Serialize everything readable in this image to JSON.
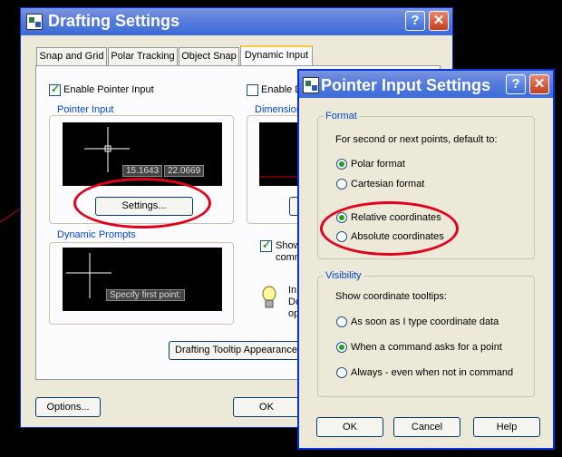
{
  "drafting": {
    "title": "Drafting Settings",
    "tabs": [
      "Snap and Grid",
      "Polar Tracking",
      "Object Snap",
      "Dynamic Input"
    ],
    "enable_pointer": "Enable Pointer Input",
    "enable_dim": "Enable D",
    "pointer_group": "Pointer Input",
    "dim_group": "Dimension",
    "coords": [
      "15.1643",
      "22.0669"
    ],
    "settings_btn": "Settings...",
    "prompts_group": "Dynamic Prompts",
    "prompt_tip": "Specify first point:",
    "show_lines": [
      "Show",
      "comm"
    ],
    "info_lines": [
      "In",
      "Do",
      "op"
    ],
    "appearance_btn": "Drafting Tooltip Appearance...",
    "options_btn": "Options...",
    "ok_btn": "OK"
  },
  "pointer_dialog": {
    "title": "Pointer Input Settings",
    "format_group": "Format",
    "format_desc": "For second or next points, default to:",
    "polar": "Polar format",
    "cartesian": "Cartesian format",
    "relative": "Relative coordinates",
    "absolute": "Absolute coordinates",
    "visibility_group": "Visibility",
    "visibility_desc": "Show coordinate tooltips:",
    "opt_type": "As soon as I type coordinate data",
    "opt_command": "When a command asks for a point",
    "opt_always": "Always - even when not in command",
    "ok_btn": "OK",
    "cancel_btn": "Cancel",
    "help_btn": "Help"
  },
  "colors": {
    "highlight_ellipse": "#e3001b",
    "title_bar": "#3b6cd7",
    "dialog_bg": "#ece9d8"
  }
}
